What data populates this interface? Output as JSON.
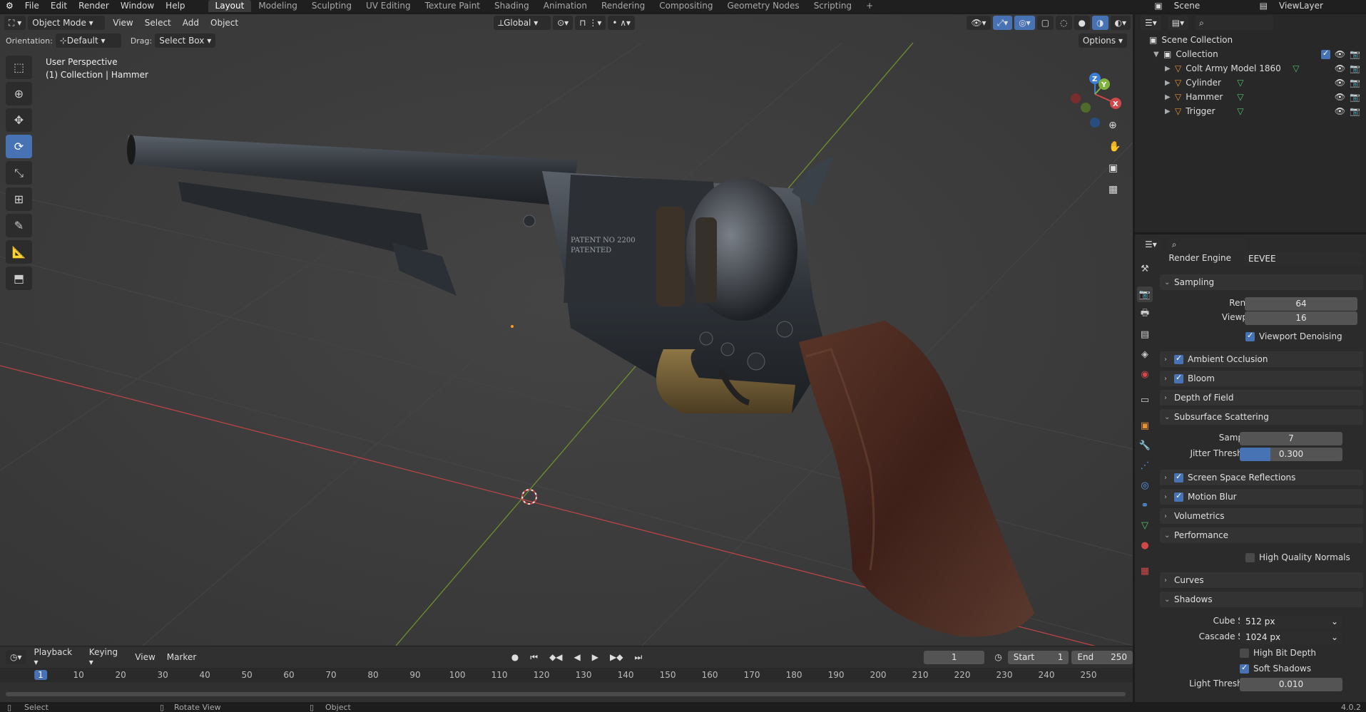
{
  "menu": [
    "File",
    "Edit",
    "Render",
    "Window",
    "Help"
  ],
  "workspaces": [
    "Layout",
    "Modeling",
    "Sculpting",
    "UV Editing",
    "Texture Paint",
    "Shading",
    "Animation",
    "Rendering",
    "Compositing",
    "Geometry Nodes",
    "Scripting"
  ],
  "active_workspace": "Layout",
  "scene": "Scene",
  "view_layer": "ViewLayer",
  "viewport": {
    "mode": "Object Mode",
    "menus": [
      "View",
      "Select",
      "Add",
      "Object"
    ],
    "transform": "Global",
    "orientation_label": "Orientation:",
    "orientation": "Default",
    "drag_label": "Drag:",
    "drag": "Select Box",
    "options": "Options",
    "overlay_title": "User Perspective",
    "overlay_sub": "(1) Collection | Hammer",
    "cylinder_text1": "PATENT NO 2200",
    "cylinder_text2": "PATENTED"
  },
  "outliner": {
    "root": "Scene Collection",
    "collection": "Collection",
    "items": [
      "Colt Army Model 1860",
      "Cylinder",
      "Hammer",
      "Trigger"
    ]
  },
  "props": {
    "render_engine_label": "Render Engine",
    "render_engine": "EEVEE",
    "sampling": "Sampling",
    "render_label": "Render",
    "render_val": "64",
    "viewport_label": "Viewport",
    "viewport_val": "16",
    "denoise": "Viewport Denoising",
    "ao": "Ambient Occlusion",
    "bloom": "Bloom",
    "dof": "Depth of Field",
    "sss": "Subsurface Scattering",
    "samples_label": "Samples",
    "samples_val": "7",
    "jitter_label": "Jitter Threshold",
    "jitter_val": "0.300",
    "jitter_fill": 0.3,
    "ssr": "Screen Space Reflections",
    "mblur": "Motion Blur",
    "volumetrics": "Volumetrics",
    "performance": "Performance",
    "hq_normals": "High Quality Normals",
    "curves": "Curves",
    "shadows": "Shadows",
    "cube_label": "Cube Size",
    "cube_val": "512 px",
    "cascade_label": "Cascade Size",
    "cascade_val": "1024 px",
    "high_bit": "High Bit Depth",
    "soft_shadows": "Soft Shadows",
    "light_thr_label": "Light Threshold",
    "light_thr_val": "0.010"
  },
  "timeline": {
    "menus": [
      "Playback",
      "Keying",
      "View",
      "Marker"
    ],
    "current": "1",
    "start_label": "Start",
    "start": "1",
    "end_label": "End",
    "end": "250",
    "ticks": [
      "1",
      "10",
      "20",
      "30",
      "40",
      "50",
      "60",
      "70",
      "80",
      "90",
      "100",
      "110",
      "120",
      "130",
      "140",
      "150",
      "160",
      "170",
      "180",
      "190",
      "200",
      "210",
      "220",
      "230",
      "240",
      "250"
    ]
  },
  "status": {
    "select": "Select",
    "rotate": "Rotate View",
    "object": "Object",
    "version": "4.0.2"
  },
  "colors": {
    "accent": "#4772b3",
    "x_axis": "#d0484a",
    "y_axis": "#7fb13c",
    "z_axis": "#3b7dd8"
  }
}
